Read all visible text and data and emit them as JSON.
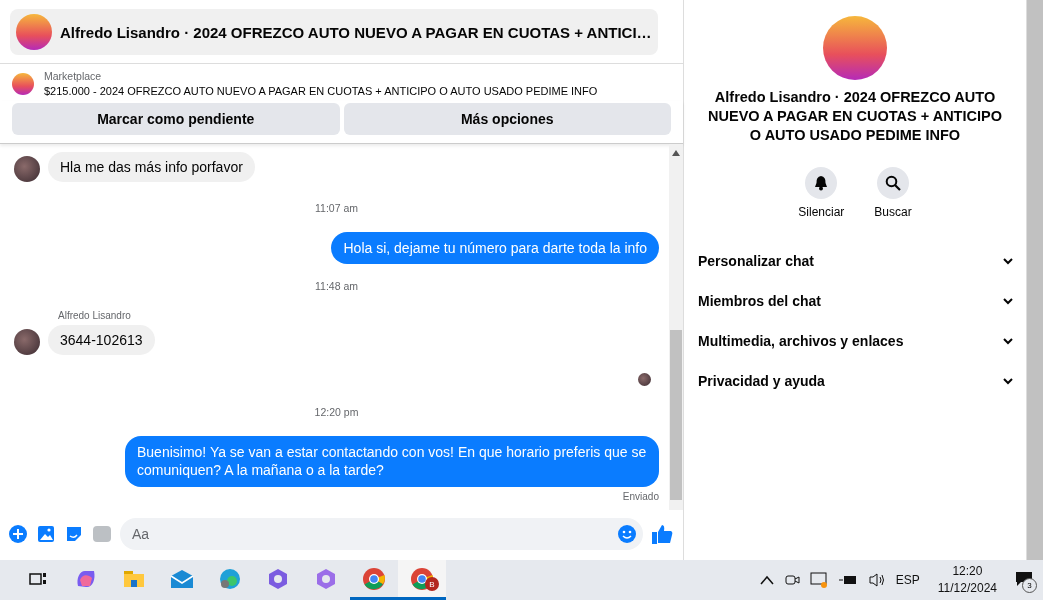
{
  "header": {
    "title": "Alfredo Lisandro · 2024 OFREZCO AUTO NUEVO A PAGAR EN CUOTAS + ANTICI…"
  },
  "listing": {
    "source": "Marketplace",
    "description": "$215.000 - 2024 OFREZCO AUTO NUEVO A PAGAR EN CUOTAS + ANTICIPO O AUTO USADO PEDIME INFO"
  },
  "actions": [
    "Marcar como pendiente",
    "Más opciones"
  ],
  "messages": [
    {
      "kind": "incoming",
      "text": "Hla me das más info porfavor"
    },
    {
      "kind": "time",
      "text": "11:07 am"
    },
    {
      "kind": "outgoing",
      "text": "Hola si, dejame tu número para darte toda la info"
    },
    {
      "kind": "time",
      "text": "11:48 am"
    },
    {
      "kind": "incoming",
      "sender": "Alfredo Lisandro",
      "text": "3644-102613"
    },
    {
      "kind": "seen"
    },
    {
      "kind": "time",
      "text": "12:20 pm"
    },
    {
      "kind": "outgoing",
      "text": "Buenisimo! Ya se van a estar contactando con vos! En que horario preferis que se comuniquen? A la mañana o a la tarde?",
      "status": "Enviado"
    }
  ],
  "composer": {
    "placeholder": "Aa"
  },
  "profile": {
    "title": "Alfredo Lisandro · 2024 OFREZCO AUTO NUEVO A PAGAR EN CUOTAS + ANTICIPO O AUTO USADO PEDIME INFO",
    "buttons": [
      {
        "kind": "mute",
        "label": "Silenciar"
      },
      {
        "kind": "search",
        "label": "Buscar"
      }
    ],
    "sections": [
      {
        "label": "Personalizar chat",
        "expanded": false
      },
      {
        "label": "Miembros del chat",
        "expanded": false
      },
      {
        "label": "Multimedia, archivos y enlaces",
        "expanded": false
      },
      {
        "label": "Privacidad y ayuda",
        "expanded": false
      }
    ]
  },
  "taskbar": {
    "apps": [
      {
        "kind": "taskview",
        "open": false,
        "selected": false
      },
      {
        "kind": "copilot",
        "open": false,
        "selected": false
      },
      {
        "kind": "files",
        "open": false,
        "selected": false
      },
      {
        "kind": "mail",
        "open": false,
        "selected": false
      },
      {
        "kind": "edge",
        "open": false,
        "selected": false
      },
      {
        "kind": "m365",
        "open": false,
        "selected": false
      },
      {
        "kind": "m365b",
        "open": false,
        "selected": false
      },
      {
        "kind": "chrome",
        "open": true,
        "selected": false
      },
      {
        "kind": "chrome-b",
        "open": true,
        "selected": true,
        "badge": "B"
      }
    ],
    "language": "ESP",
    "time": "12:20",
    "date": "11/12/2024",
    "notifications": "3"
  }
}
